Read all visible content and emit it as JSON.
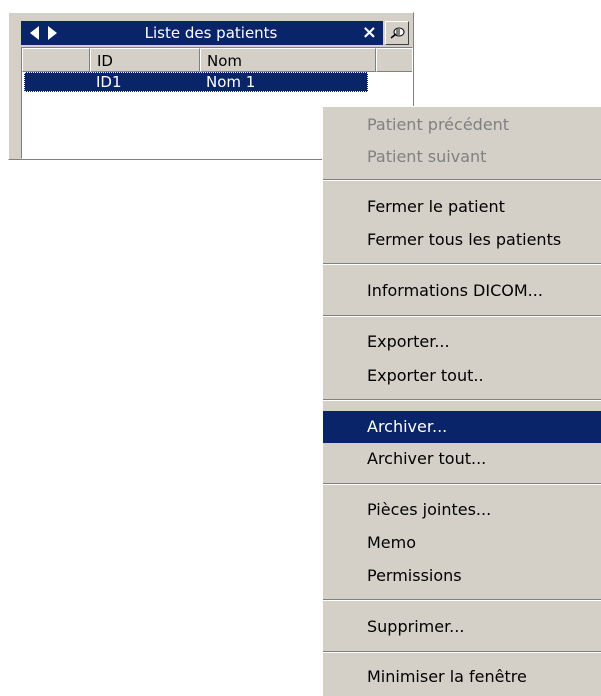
{
  "panel": {
    "title": "Liste des patients",
    "close_glyph": "×",
    "nav_left_icon": "arrow-left-icon",
    "nav_right_icon": "arrow-right-icon",
    "pin_icon": "pushpin-icon",
    "columns": [
      "ID",
      "Nom"
    ],
    "rows": [
      {
        "id": "ID1",
        "name": "Nom 1"
      }
    ]
  },
  "menu": {
    "items": [
      {
        "label": "Patient précédent",
        "enabled": false
      },
      {
        "label": "Patient suivant",
        "enabled": false
      },
      {
        "label": "Fermer le patient",
        "enabled": true
      },
      {
        "label": "Fermer tous les patients",
        "enabled": true
      },
      {
        "label": "Informations DICOM...",
        "enabled": true
      },
      {
        "label": "Exporter...",
        "enabled": true
      },
      {
        "label": "Exporter tout..",
        "enabled": true
      },
      {
        "label": "Archiver...",
        "enabled": true,
        "highlighted": true
      },
      {
        "label": "Archiver tout...",
        "enabled": true
      },
      {
        "label": "Pièces jointes...",
        "enabled": true
      },
      {
        "label": "Memo",
        "enabled": true
      },
      {
        "label": "Permissions",
        "enabled": true
      },
      {
        "label": "Supprimer...",
        "enabled": true
      },
      {
        "label": "Minimiser la fenêtre",
        "enabled": true
      }
    ]
  },
  "colors": {
    "selection": "#0a246a",
    "face": "#d4d0c8",
    "disabled_text": "#808080"
  }
}
